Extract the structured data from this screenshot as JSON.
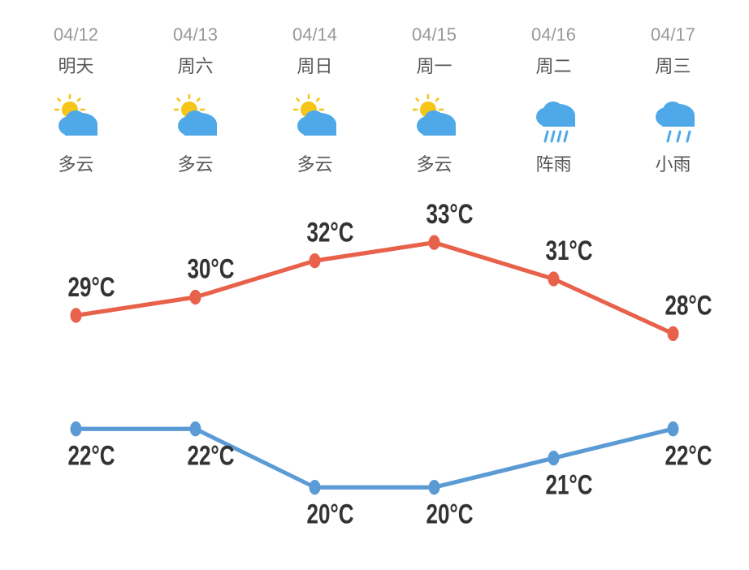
{
  "columns": [
    {
      "date": "04/12",
      "day": "明天",
      "weather": "cloudy_sun",
      "desc": "多云",
      "high": 29,
      "low": 22
    },
    {
      "date": "04/13",
      "day": "周六",
      "weather": "cloudy_sun",
      "desc": "多云",
      "high": 30,
      "low": 22
    },
    {
      "date": "04/14",
      "day": "周日",
      "weather": "cloudy_sun",
      "desc": "多云",
      "high": 32,
      "low": 20
    },
    {
      "date": "04/15",
      "day": "周一",
      "weather": "cloudy_sun",
      "desc": "多云",
      "high": 33,
      "low": 20
    },
    {
      "date": "04/16",
      "day": "周二",
      "weather": "rain",
      "desc": "阵雨",
      "high": 31,
      "low": 21
    },
    {
      "date": "04/17",
      "day": "周三",
      "weather": "light_rain",
      "desc": "小雨",
      "high": 28,
      "low": 22
    }
  ],
  "colors": {
    "high": "#E8614A",
    "low": "#5B9BD5",
    "date": "#999999",
    "day": "#555555",
    "desc": "#555555",
    "high_label": "#333333",
    "low_label": "#333333"
  }
}
